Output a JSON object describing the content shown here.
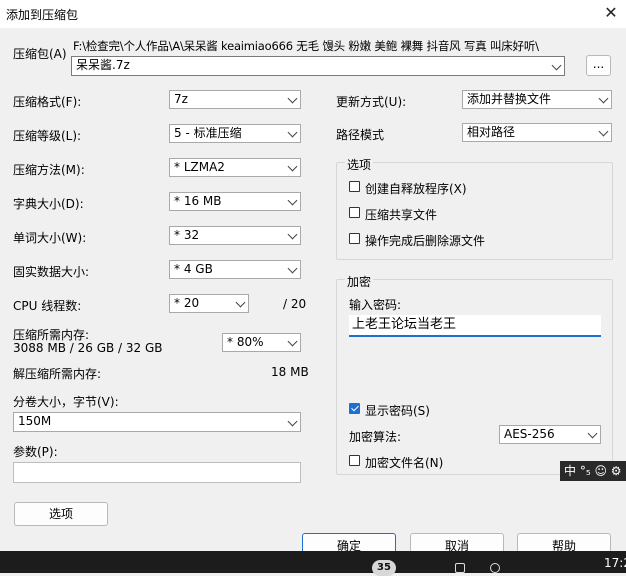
{
  "window": {
    "title": "添加到压缩包",
    "close_glyph": "✕"
  },
  "archive": {
    "label": "压缩包(A)",
    "path": "F:\\检查完\\个人作品\\A\\呆呆酱 keaimiao666 无毛 馒头 粉嫩 美鲍 裸舞 抖音风 写真 叫床好听\\",
    "filename": "呆呆酱.7z",
    "browse_label": "..."
  },
  "left": {
    "format": {
      "label": "压缩格式(F):",
      "value": "7z"
    },
    "level": {
      "label": "压缩等级(L):",
      "value": "5 - 标准压缩"
    },
    "method": {
      "label": "压缩方法(M):",
      "value": "* LZMA2"
    },
    "dict": {
      "label": "字典大小(D):",
      "value": "* 16 MB"
    },
    "word": {
      "label": "单词大小(W):",
      "value": "* 32"
    },
    "solid": {
      "label": "固实数据大小:",
      "value": "* 4 GB"
    },
    "threads": {
      "label": "CPU 线程数:",
      "value": "* 20",
      "max": "/ 20"
    },
    "memory": {
      "label": "压缩所需内存:",
      "detail": "3088 MB / 26 GB / 32 GB",
      "value": "* 80%"
    },
    "decompress": {
      "label": "解压缩所需内存:",
      "value": "18 MB"
    },
    "split": {
      "label": "分卷大小，字节(V):",
      "value": "150M"
    },
    "params": {
      "label": "参数(P):",
      "value": ""
    },
    "options_button": "选项"
  },
  "right": {
    "update": {
      "label": "更新方式(U):",
      "value": "添加并替换文件"
    },
    "pathmode": {
      "label": "路径模式",
      "value": "相对路径"
    },
    "options": {
      "title": "选项",
      "items": [
        {
          "label": "创建自释放程序(X)",
          "checked": false
        },
        {
          "label": "压缩共享文件",
          "checked": false
        },
        {
          "label": "操作完成后删除源文件",
          "checked": false
        }
      ]
    },
    "encryption": {
      "title": "加密",
      "password_label": "输入密码:",
      "password": "上老王论坛当老王",
      "show_password": {
        "label": "显示密码(S)",
        "checked": true
      },
      "method_label": "加密算法:",
      "method_value": "AES-256",
      "encrypt_names": {
        "label": "加密文件名(N)",
        "checked": false
      }
    }
  },
  "buttons": {
    "ok": "确定",
    "cancel": "取消",
    "help": "帮助"
  },
  "overlay": {
    "ime_text": "中 °₅ ☺ ⚙",
    "taskbar_badge": "35",
    "taskbar_time": "17:2"
  },
  "colors": {
    "accent": "#1f6fd1",
    "taskbar": "#1c1c1c"
  }
}
